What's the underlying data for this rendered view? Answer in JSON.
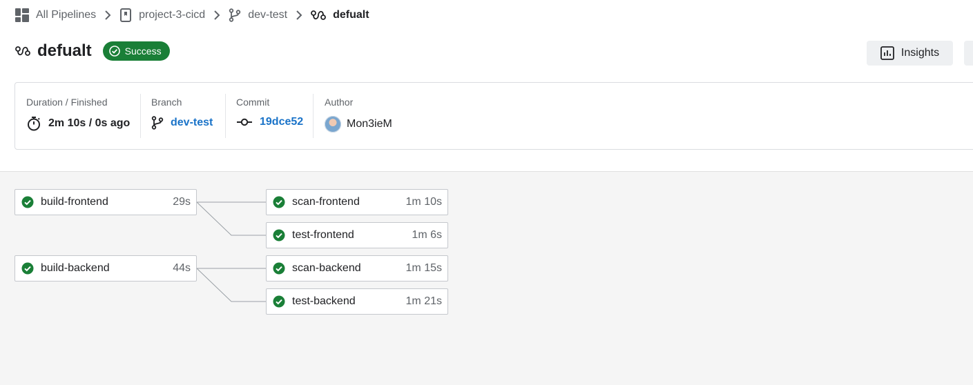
{
  "breadcrumb": {
    "items": [
      {
        "label": "All Pipelines",
        "icon": "grid-icon"
      },
      {
        "label": "project-3-cicd",
        "icon": "repository-icon"
      },
      {
        "label": "dev-test",
        "icon": "branch-icon"
      },
      {
        "label": "defualt",
        "icon": "pipeline-icon"
      }
    ]
  },
  "header": {
    "title": "defualt",
    "status": "Success",
    "insights_label": "Insights"
  },
  "summary": {
    "duration": {
      "label": "Duration / Finished",
      "value": "2m 10s / 0s ago"
    },
    "branch": {
      "label": "Branch",
      "value": "dev-test"
    },
    "commit": {
      "label": "Commit",
      "value": "19dce52"
    },
    "author": {
      "label": "Author",
      "value": "Mon3ieM"
    }
  },
  "stages": [
    {
      "jobs": [
        {
          "name": "build-frontend",
          "duration": "29s",
          "status": "success"
        },
        {
          "name": "build-backend",
          "duration": "44s",
          "status": "success"
        }
      ]
    },
    {
      "jobs": [
        {
          "name": "scan-frontend",
          "duration": "1m 10s",
          "status": "success"
        },
        {
          "name": "test-frontend",
          "duration": "1m 6s",
          "status": "success"
        },
        {
          "name": "scan-backend",
          "duration": "1m 15s",
          "status": "success"
        },
        {
          "name": "test-backend",
          "duration": "1m 21s",
          "status": "success"
        }
      ]
    }
  ],
  "colors": {
    "success": "#1a7f37",
    "link": "#1a73c8",
    "graph_background": "#f5f5f5"
  }
}
